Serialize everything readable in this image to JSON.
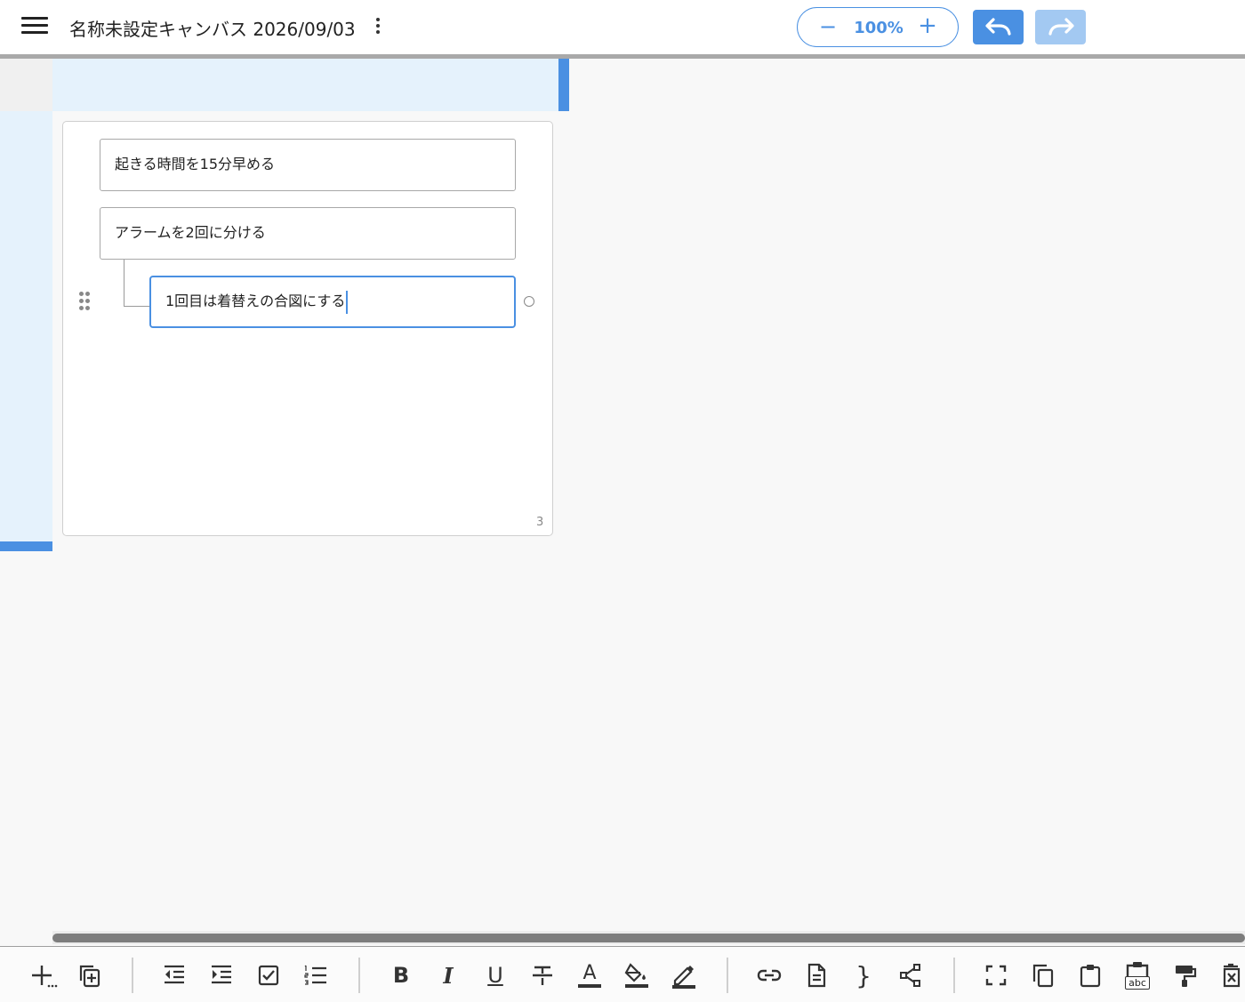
{
  "header": {
    "title": "名称未設定キャンバス 2026/09/03",
    "zoom_value": "100%",
    "zoom_minus": "−",
    "zoom_plus": "+"
  },
  "nodes": [
    {
      "text": "起きる時間を15分早める"
    },
    {
      "text": "アラームを2回に分ける"
    },
    {
      "text": "1回目は着替えの合図にする"
    }
  ],
  "card": {
    "node_count": "3"
  },
  "toolbar": {
    "bold": "B",
    "italic": "I",
    "underline": "U",
    "brace": "}",
    "text_color": "A",
    "abc": "abc"
  },
  "colors": {
    "accent": "#4a90e2",
    "accent_light": "#a3c9f2",
    "panel": "#e5f2fc"
  }
}
